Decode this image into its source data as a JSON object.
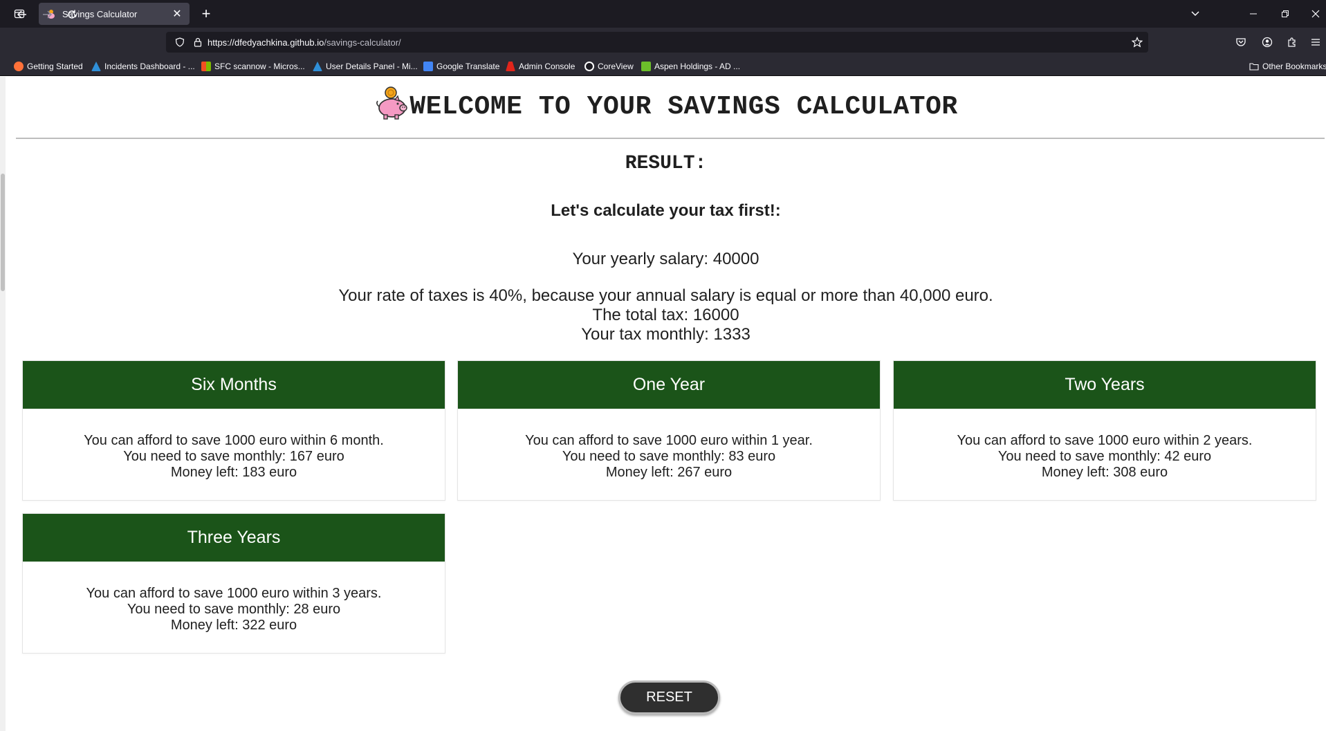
{
  "browser": {
    "tab": {
      "title": "Savings Calculator"
    },
    "url": {
      "host": "https://dfedyachkina.github.io",
      "path": "/savings-calculator/"
    },
    "bookmarks": [
      {
        "label": "Getting Started",
        "icon": "firefox-icon",
        "color": "#ff7139"
      },
      {
        "label": "Incidents Dashboard - ...",
        "icon": "azure-icon",
        "color": "#2f8fd8"
      },
      {
        "label": "SFC scannow - Micros...",
        "icon": "microsoft-icon",
        "color": "#f25022"
      },
      {
        "label": "User Details Panel - Mi...",
        "icon": "azure-icon",
        "color": "#2f8fd8"
      },
      {
        "label": "Google Translate",
        "icon": "translate-icon",
        "color": "#4285f4"
      },
      {
        "label": "Admin Console",
        "icon": "adobe-icon",
        "color": "#e1251b"
      },
      {
        "label": "CoreView",
        "icon": "coreview-icon",
        "color": "#ffffff"
      },
      {
        "label": "Aspen Holdings - AD ...",
        "icon": "aspen-icon",
        "color": "#6cbf2a"
      }
    ],
    "other_bookmarks": "Other Bookmarks"
  },
  "page": {
    "title": "WELCOME TO YOUR SAVINGS CALCULATOR",
    "result_label": "RESULT:",
    "tax_title": "Let's calculate your tax first!:",
    "salary_line": "Your yearly salary: 40000",
    "tax_rate_line": "Your rate of taxes is 40%, because your annual salary is equal or more than 40,000 euro.",
    "total_tax_line": "The total tax: 16000",
    "monthly_tax_line": "Your tax monthly: 1333",
    "cards": [
      {
        "title": "Six Months",
        "afford": "You can afford to save 1000 euro within 6 month.",
        "monthly": "You need to save monthly: 167 euro",
        "left": "Money left: 183 euro"
      },
      {
        "title": "One Year",
        "afford": "You can afford to save 1000 euro within 1 year.",
        "monthly": "You need to save monthly: 83 euro",
        "left": "Money left: 267 euro"
      },
      {
        "title": "Two Years",
        "afford": "You can afford to save 1000 euro within 2 years.",
        "monthly": "You need to save monthly: 42 euro",
        "left": "Money left: 308 euro"
      },
      {
        "title": "Three Years",
        "afford": "You can afford to save 1000 euro within 3 years.",
        "monthly": "You need to save monthly: 28 euro",
        "left": "Money left: 322 euro"
      }
    ],
    "reset_label": "RESET",
    "colors": {
      "card_header": "#1b5419",
      "button": "#2f2f2f"
    }
  }
}
